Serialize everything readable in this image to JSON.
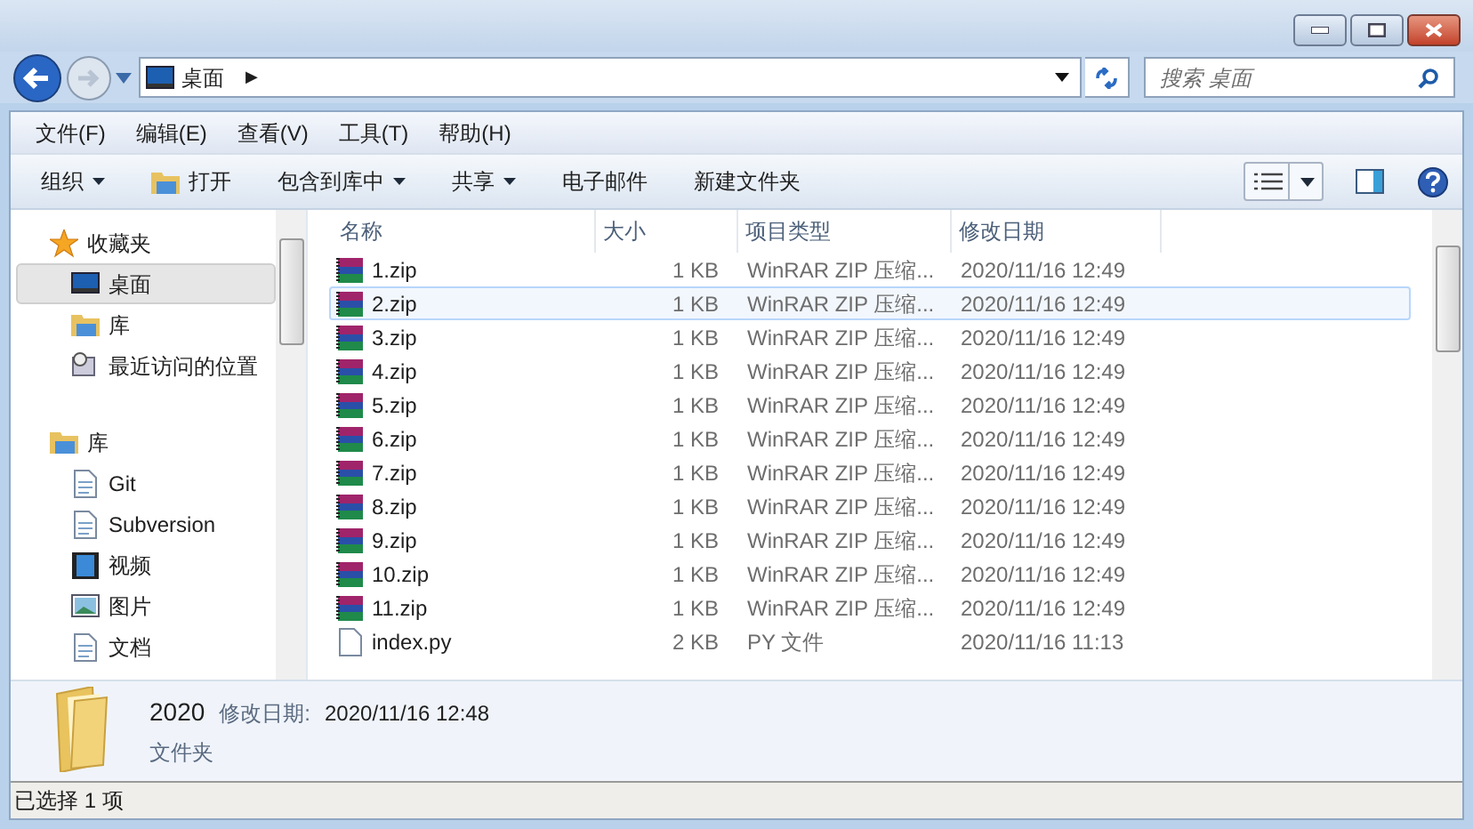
{
  "address_bar": {
    "location": "桌面",
    "separator": "▶"
  },
  "search": {
    "placeholder": "搜索 桌面"
  },
  "menu": [
    "文件(F)",
    "编辑(E)",
    "查看(V)",
    "工具(T)",
    "帮助(H)"
  ],
  "toolbar": [
    {
      "label": "组织",
      "dropdown": true,
      "icon": false
    },
    {
      "label": "打开",
      "dropdown": false,
      "icon": true
    },
    {
      "label": "包含到库中",
      "dropdown": true,
      "icon": false
    },
    {
      "label": "共享",
      "dropdown": true,
      "icon": false
    },
    {
      "label": "电子邮件",
      "dropdown": false,
      "icon": false
    },
    {
      "label": "新建文件夹",
      "dropdown": false,
      "icon": false
    }
  ],
  "sidebar": [
    {
      "label": "收藏夹",
      "kind": "star",
      "children": [
        {
          "label": "桌面",
          "kind": "desktop",
          "selected": true
        },
        {
          "label": "库",
          "kind": "library",
          "selected": false
        },
        {
          "label": "最近访问的位置",
          "kind": "recent",
          "selected": false
        }
      ]
    },
    {
      "label": "库",
      "kind": "library",
      "children": [
        {
          "label": "Git",
          "kind": "doc",
          "selected": false
        },
        {
          "label": "Subversion",
          "kind": "doc",
          "selected": false
        },
        {
          "label": "视频",
          "kind": "video",
          "selected": false
        },
        {
          "label": "图片",
          "kind": "picture",
          "selected": false
        },
        {
          "label": "文档",
          "kind": "doc",
          "selected": false
        }
      ]
    }
  ],
  "table": {
    "columns": [
      "名称",
      "大小",
      "项目类型",
      "修改日期"
    ],
    "rows": [
      {
        "name": "1.zip",
        "size": "1 KB",
        "type": "WinRAR ZIP 压缩...",
        "modified": "2020/11/16 12:49",
        "kind": "zip",
        "selected": false
      },
      {
        "name": "2.zip",
        "size": "1 KB",
        "type": "WinRAR ZIP 压缩...",
        "modified": "2020/11/16 12:49",
        "kind": "zip",
        "selected": true
      },
      {
        "name": "3.zip",
        "size": "1 KB",
        "type": "WinRAR ZIP 压缩...",
        "modified": "2020/11/16 12:49",
        "kind": "zip",
        "selected": false
      },
      {
        "name": "4.zip",
        "size": "1 KB",
        "type": "WinRAR ZIP 压缩...",
        "modified": "2020/11/16 12:49",
        "kind": "zip",
        "selected": false
      },
      {
        "name": "5.zip",
        "size": "1 KB",
        "type": "WinRAR ZIP 压缩...",
        "modified": "2020/11/16 12:49",
        "kind": "zip",
        "selected": false
      },
      {
        "name": "6.zip",
        "size": "1 KB",
        "type": "WinRAR ZIP 压缩...",
        "modified": "2020/11/16 12:49",
        "kind": "zip",
        "selected": false
      },
      {
        "name": "7.zip",
        "size": "1 KB",
        "type": "WinRAR ZIP 压缩...",
        "modified": "2020/11/16 12:49",
        "kind": "zip",
        "selected": false
      },
      {
        "name": "8.zip",
        "size": "1 KB",
        "type": "WinRAR ZIP 压缩...",
        "modified": "2020/11/16 12:49",
        "kind": "zip",
        "selected": false
      },
      {
        "name": "9.zip",
        "size": "1 KB",
        "type": "WinRAR ZIP 压缩...",
        "modified": "2020/11/16 12:49",
        "kind": "zip",
        "selected": false
      },
      {
        "name": "10.zip",
        "size": "1 KB",
        "type": "WinRAR ZIP 压缩...",
        "modified": "2020/11/16 12:49",
        "kind": "zip",
        "selected": false
      },
      {
        "name": "11.zip",
        "size": "1 KB",
        "type": "WinRAR ZIP 压缩...",
        "modified": "2020/11/16 12:49",
        "kind": "zip",
        "selected": false
      },
      {
        "name": "index.py",
        "size": "2 KB",
        "type": "PY 文件",
        "modified": "2020/11/16 11:13",
        "kind": "file",
        "selected": false
      }
    ]
  },
  "details": {
    "name": "2020",
    "date_label": "修改日期:",
    "date": "2020/11/16 12:48",
    "type": "文件夹"
  },
  "status_bar": "已选择 1 项"
}
